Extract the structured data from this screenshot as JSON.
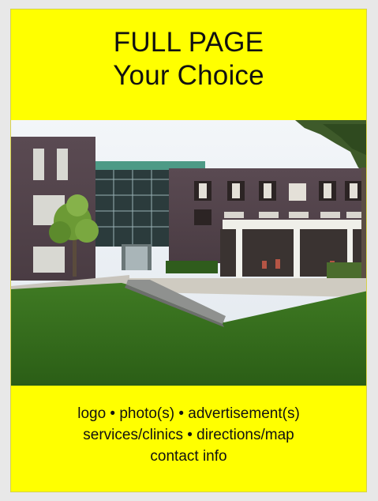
{
  "header": {
    "line1": "FULL PAGE",
    "line2": "Your Choice"
  },
  "photo": {
    "subject": "building-photo"
  },
  "details": {
    "line1": "logo • photo(s) • advertisement(s)",
    "line2": "services/clinics • directions/map",
    "line3": "contact info"
  },
  "colors": {
    "panel_background": "#ffff00",
    "page_background": "#e8e8e8",
    "text": "#111111"
  }
}
